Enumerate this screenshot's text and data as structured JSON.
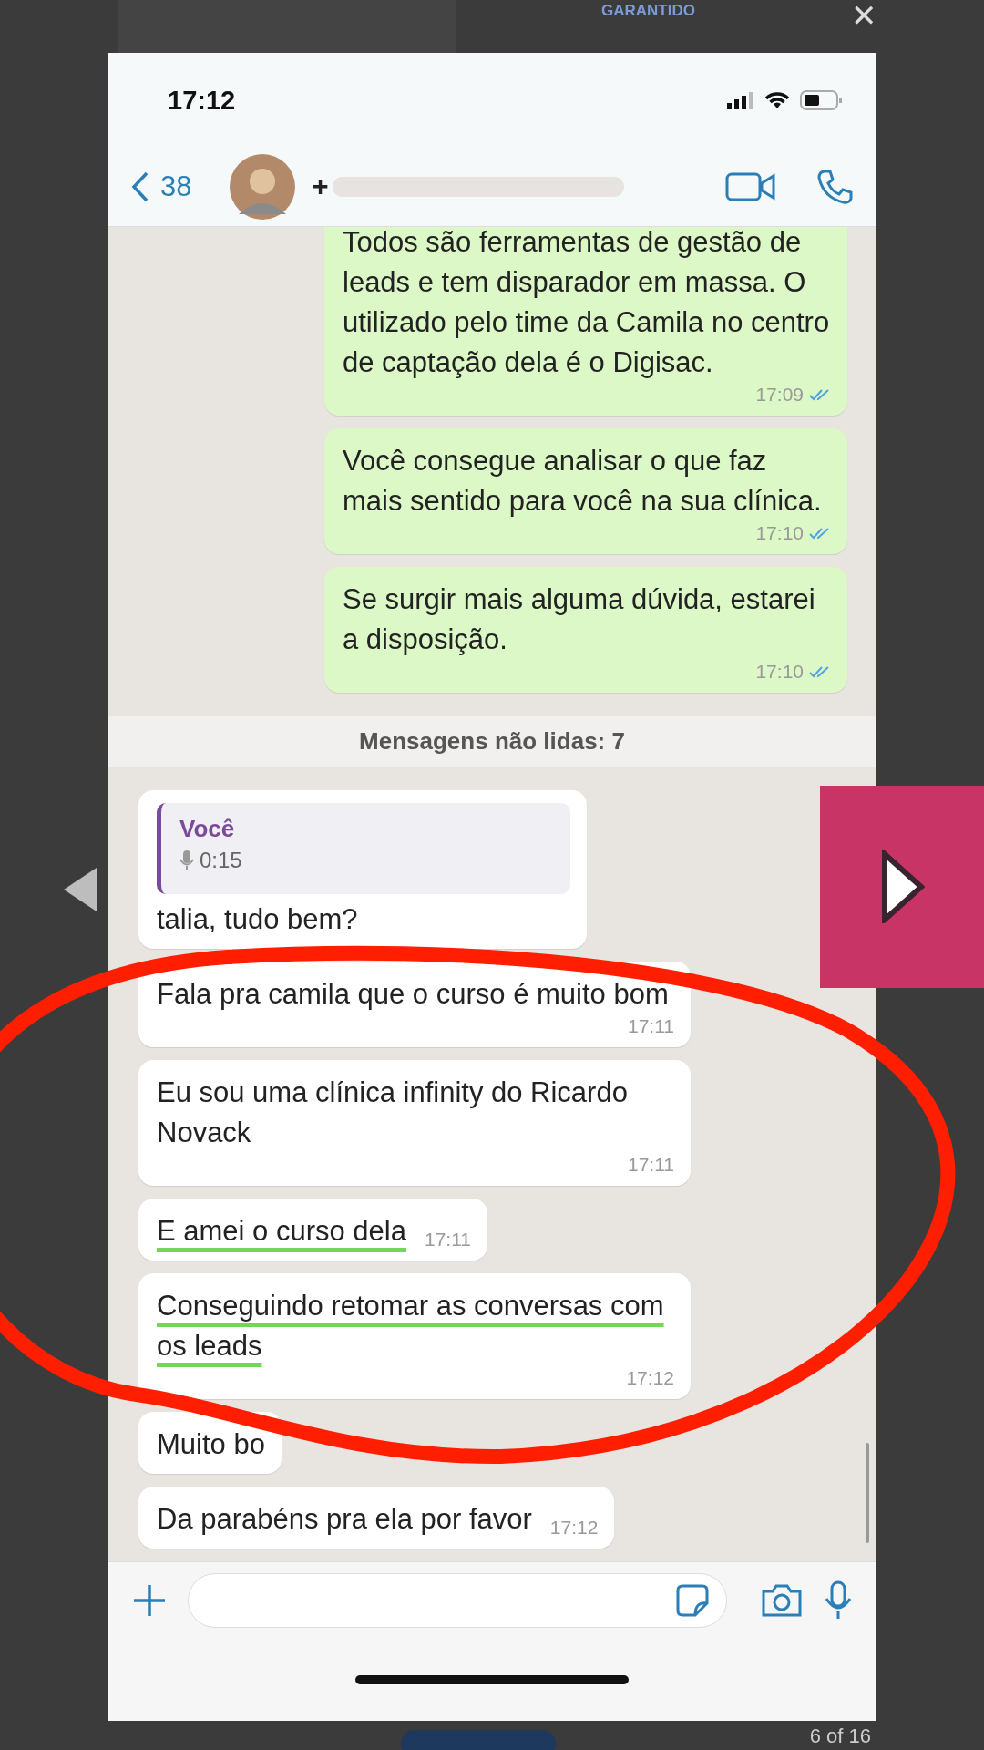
{
  "lightbox": {
    "backdrop_text": "GARANTIDO",
    "close": "✕",
    "counter": "6 of 16"
  },
  "phone": {
    "time": "17:12",
    "back_count": "38",
    "contact": "+",
    "messages": [
      {
        "kind": "out",
        "text": "Todos são ferramentas de gestão de leads e tem disparador em massa. O utilizado pelo time da Camila no centro de captação dela é o Digisac.",
        "time": "17:09",
        "read": true
      },
      {
        "kind": "out",
        "text": "Você consegue analisar o que faz mais sentido para você na sua clínica.",
        "time": "17:10",
        "read": true
      },
      {
        "kind": "out",
        "text": "Se surgir mais alguma dúvida, estarei a disposição.",
        "time": "17:10",
        "read": true
      },
      {
        "kind": "divider",
        "text": "Mensagens não lidas: 7"
      },
      {
        "kind": "in",
        "quote": {
          "author": "Você",
          "duration": "0:15"
        },
        "text": "talia, tudo bem?"
      },
      {
        "kind": "in",
        "text": "Fala pra camila que o curso é muito bom",
        "time": "17:11",
        "underlined": false
      },
      {
        "kind": "in",
        "text": "Eu sou uma clínica infinity do Ricardo Novack",
        "time": "17:11",
        "underlined": false
      },
      {
        "kind": "in",
        "text": "E amei o curso dela",
        "time": "17:11",
        "underlined": true
      },
      {
        "kind": "in",
        "text": "Conseguindo retomar as conversas com os leads",
        "time": "17:12",
        "underlined": true
      },
      {
        "kind": "in",
        "text": "Muito bo",
        "underlined": false
      },
      {
        "kind": "in",
        "text": "Da parabéns pra ela por favor",
        "time": "17:12",
        "underlined": false
      }
    ]
  }
}
